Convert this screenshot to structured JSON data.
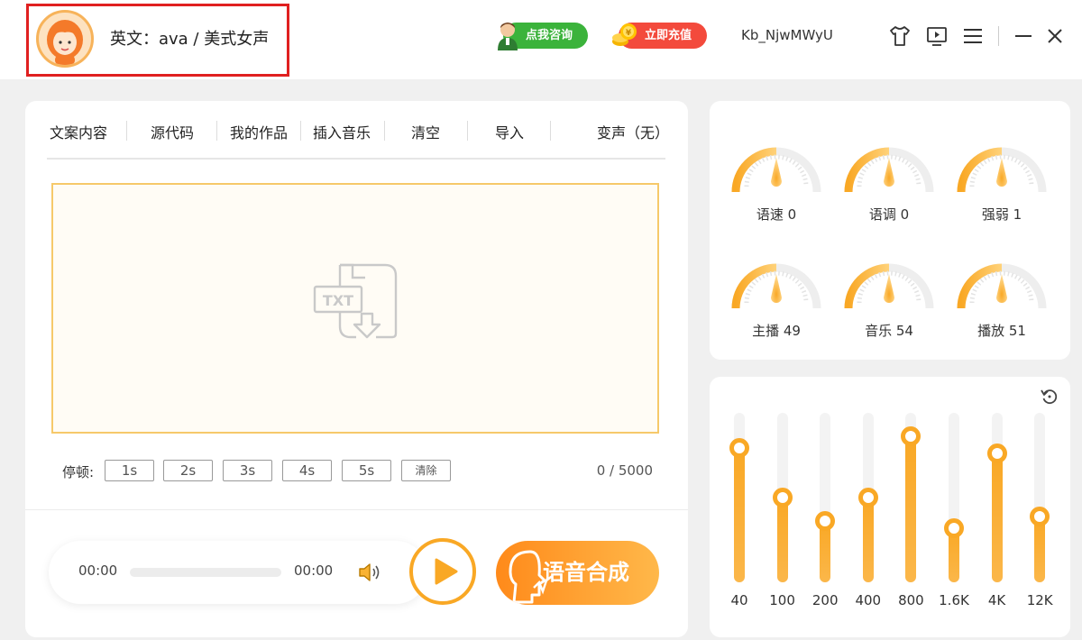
{
  "header": {
    "voice_label": "英文：ava / 美式女声",
    "consult_label": "点我咨询",
    "recharge_label": "立即充值",
    "username": "Kb_NjwMWyU",
    "icons": [
      "shirt-icon",
      "screen-icon",
      "menu-icon",
      "minimize-icon",
      "close-icon"
    ]
  },
  "tabs": [
    "文案内容",
    "源代码",
    "我的作品",
    "插入音乐",
    "清空",
    "导入",
    "变声（无）"
  ],
  "editor": {
    "placeholder_icon_text": "TXT"
  },
  "pause": {
    "label": "停顿:",
    "options": [
      "1s",
      "2s",
      "3s",
      "4s",
      "5s"
    ],
    "clear_label": "清除"
  },
  "char_count": "0 / 5000",
  "player": {
    "current_time": "00:00",
    "total_time": "00:00",
    "progress": 0
  },
  "synth_label": "语音合成",
  "knobs": [
    {
      "label": "语速 0",
      "value": 0
    },
    {
      "label": "语调 0",
      "value": 0
    },
    {
      "label": "强弱 1",
      "value": 1
    },
    {
      "label": "主播 49",
      "value": 49
    },
    {
      "label": "音乐 54",
      "value": 54
    },
    {
      "label": "播放 51",
      "value": 51
    }
  ],
  "equalizer": {
    "bands": [
      {
        "label": "40",
        "level": 0.79
      },
      {
        "label": "100",
        "level": 0.5
      },
      {
        "label": "200",
        "level": 0.36
      },
      {
        "label": "400",
        "level": 0.5
      },
      {
        "label": "800",
        "level": 0.86
      },
      {
        "label": "1.6K",
        "level": 0.32
      },
      {
        "label": "4K",
        "level": 0.76
      },
      {
        "label": "12K",
        "level": 0.39
      }
    ]
  },
  "colors": {
    "accent": "#f9a825",
    "consult": "#3bb33b",
    "recharge": "#f34a3c",
    "highlight_border": "#e02020"
  }
}
